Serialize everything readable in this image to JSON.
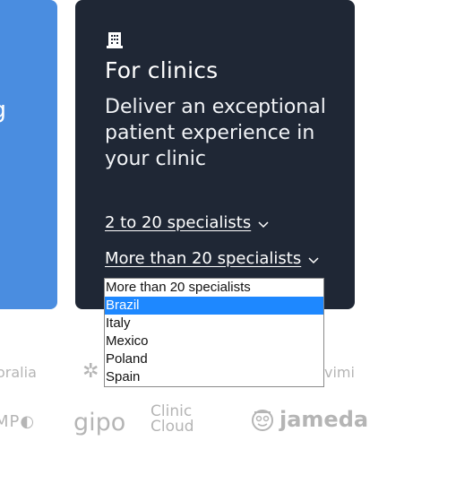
{
  "left_card": {
    "fragment": "g"
  },
  "clinics_card": {
    "icon": "building-icon",
    "title": "For clinics",
    "description": "Deliver an exceptional patient experience in your clinic",
    "options": [
      {
        "label": "2 to 20 specialists",
        "icon": "chevron-down-icon"
      },
      {
        "label": "More than 20 specialists",
        "icon": "chevron-down-icon"
      }
    ]
  },
  "country_dropdown": {
    "items": [
      "More than 20 specialists",
      "Brazil",
      "Italy",
      "Mexico",
      "Poland",
      "Spain"
    ],
    "selected": "Brazil"
  },
  "logos": {
    "oralia": "oralia",
    "vimi": "vimi",
    "mpc": "MP",
    "gipo": "gipo",
    "clinic_top": "Clinic",
    "clinic_bottom": "Cloud",
    "jameda": "jameda"
  },
  "colors": {
    "card_dark": "#1f2735",
    "card_blue": "#4a8de0",
    "selection": "#1e88ff",
    "logo_gray": "#b5b5b5"
  }
}
